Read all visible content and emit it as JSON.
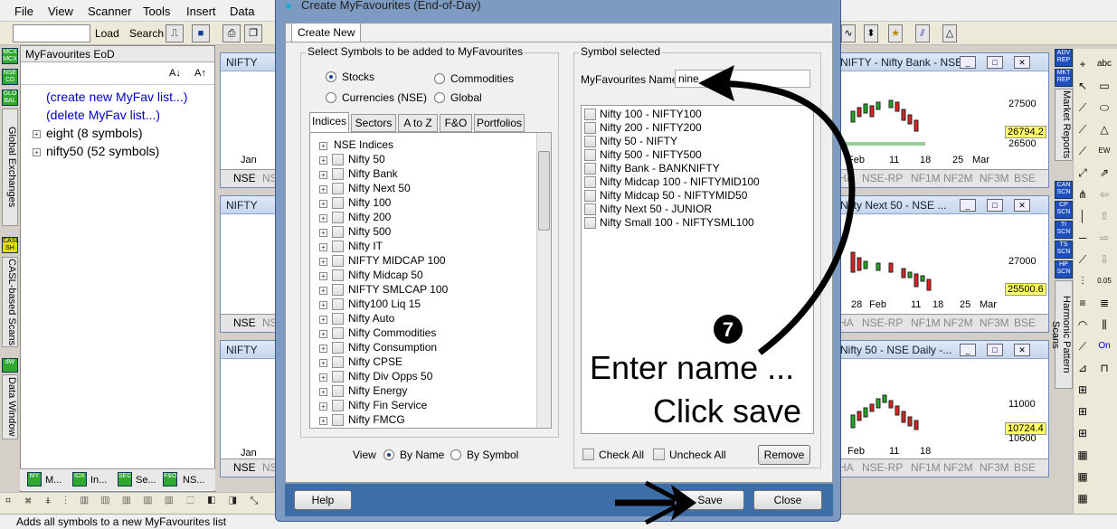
{
  "menu": [
    "File",
    "View",
    "Scanner",
    "Tools",
    "Insert",
    "Data"
  ],
  "toolbar": {
    "load": "Load",
    "search": "Search"
  },
  "left_vtabs": [
    "Global Exchanges",
    "CASL-based Scans",
    "Data Window"
  ],
  "left_icons": [
    "MCX MCX",
    "NSE CD",
    "GLO BAL",
    "CASL SH",
    "dW"
  ],
  "fav_panel": {
    "title": "MyFavourites EoD",
    "sort_az": "A↓",
    "sort_za": "A↑",
    "items": [
      "(create new MyFav list...)",
      "(delete MyFav list...)",
      "eight (8 symbols)",
      "nifty50 (52 symbols)"
    ],
    "bottom_tabs": [
      "M...",
      "In...",
      "Se...",
      "NS..."
    ]
  },
  "charts": {
    "left_title": "NIFTY",
    "right": [
      {
        "title": "NIFTY - Nifty Bank - NSE...",
        "prices": [
          "27500",
          "26500"
        ],
        "last": "26794.2",
        "months": [
          "Feb",
          "11",
          "18",
          "25",
          "Mar"
        ]
      },
      {
        "title": "Nifty Next 50 - NSE ...",
        "prices": [
          "27000"
        ],
        "last": "25500.6",
        "months": [
          "28",
          "Feb",
          "11",
          "18",
          "25",
          "Mar"
        ]
      },
      {
        "title": "Nifty 50 - NSE Daily -...",
        "prices": [
          "11000",
          "10600"
        ],
        "last": "10724.4",
        "months": [
          "Feb",
          "11",
          "18"
        ]
      }
    ],
    "left_month": "Jan",
    "exch_right": [
      "HA",
      "NSE-RP",
      "NF1M",
      "NF2M",
      "NF3M",
      "BSE"
    ],
    "exch_left": [
      "NSE",
      "NS"
    ]
  },
  "right_vtabs": [
    "Market Reports",
    "Harmonic Pattern Scans"
  ],
  "right_icons": [
    "ADV REP",
    "MKT REP",
    "CAN SCN",
    "CP SCN",
    "TI SCN",
    "TS SCN",
    "HP SCN"
  ],
  "dialog": {
    "title": "Create MyFavourites (End-of-Day)",
    "tab": "Create New",
    "left_group": "Select Symbols to be added to MyFavourites",
    "types": [
      "Stocks",
      "Commodities",
      "Currencies (NSE)",
      "Global"
    ],
    "subtabs": [
      "Indices",
      "Sectors",
      "A to Z",
      "F&O",
      "Portfolios"
    ],
    "indices": [
      "NSE Indices",
      "Nifty 50",
      "Nifty Bank",
      "Nifty Next 50",
      "Nifty 100",
      "Nifty 200",
      "Nifty 500",
      "Nifty IT",
      "NIFTY MIDCAP 100",
      "Nifty Midcap 50",
      "NIFTY SMLCAP 100",
      "Nifty100 Liq 15",
      "Nifty Auto",
      "Nifty Commodities",
      "Nifty Consumption",
      "Nifty CPSE",
      "Nifty Div Opps 50",
      "Nifty Energy",
      "Nifty Fin Service",
      "Nifty FMCG"
    ],
    "view_label": "View",
    "view_by_name": "By Name",
    "view_by_symbol": "By Symbol",
    "right_group": "Symbol selected",
    "name_label": "MyFavourites Name",
    "name_value": "nine",
    "selected": [
      "Nifty 100 - NIFTY100",
      "Nifty 200 - NIFTY200",
      "Nifty 50 - NIFTY",
      "Nifty 500 - NIFTY500",
      "Nifty Bank - BANKNIFTY",
      "Nifty Midcap 100 - NIFTYMID100",
      "Nifty Midcap 50 - NIFTYMID50",
      "Nifty Next 50 - JUNIOR",
      "Nifty Small 100 - NIFTYSML100"
    ],
    "check_all": "Check All",
    "uncheck_all": "Uncheck All",
    "remove": "Remove",
    "help": "Help",
    "save": "Save",
    "close": "Close"
  },
  "annotation": {
    "step": "7",
    "line1": "Enter name ...",
    "line2": "Click save"
  },
  "status": "Adds all symbols to a new MyFavourites list"
}
